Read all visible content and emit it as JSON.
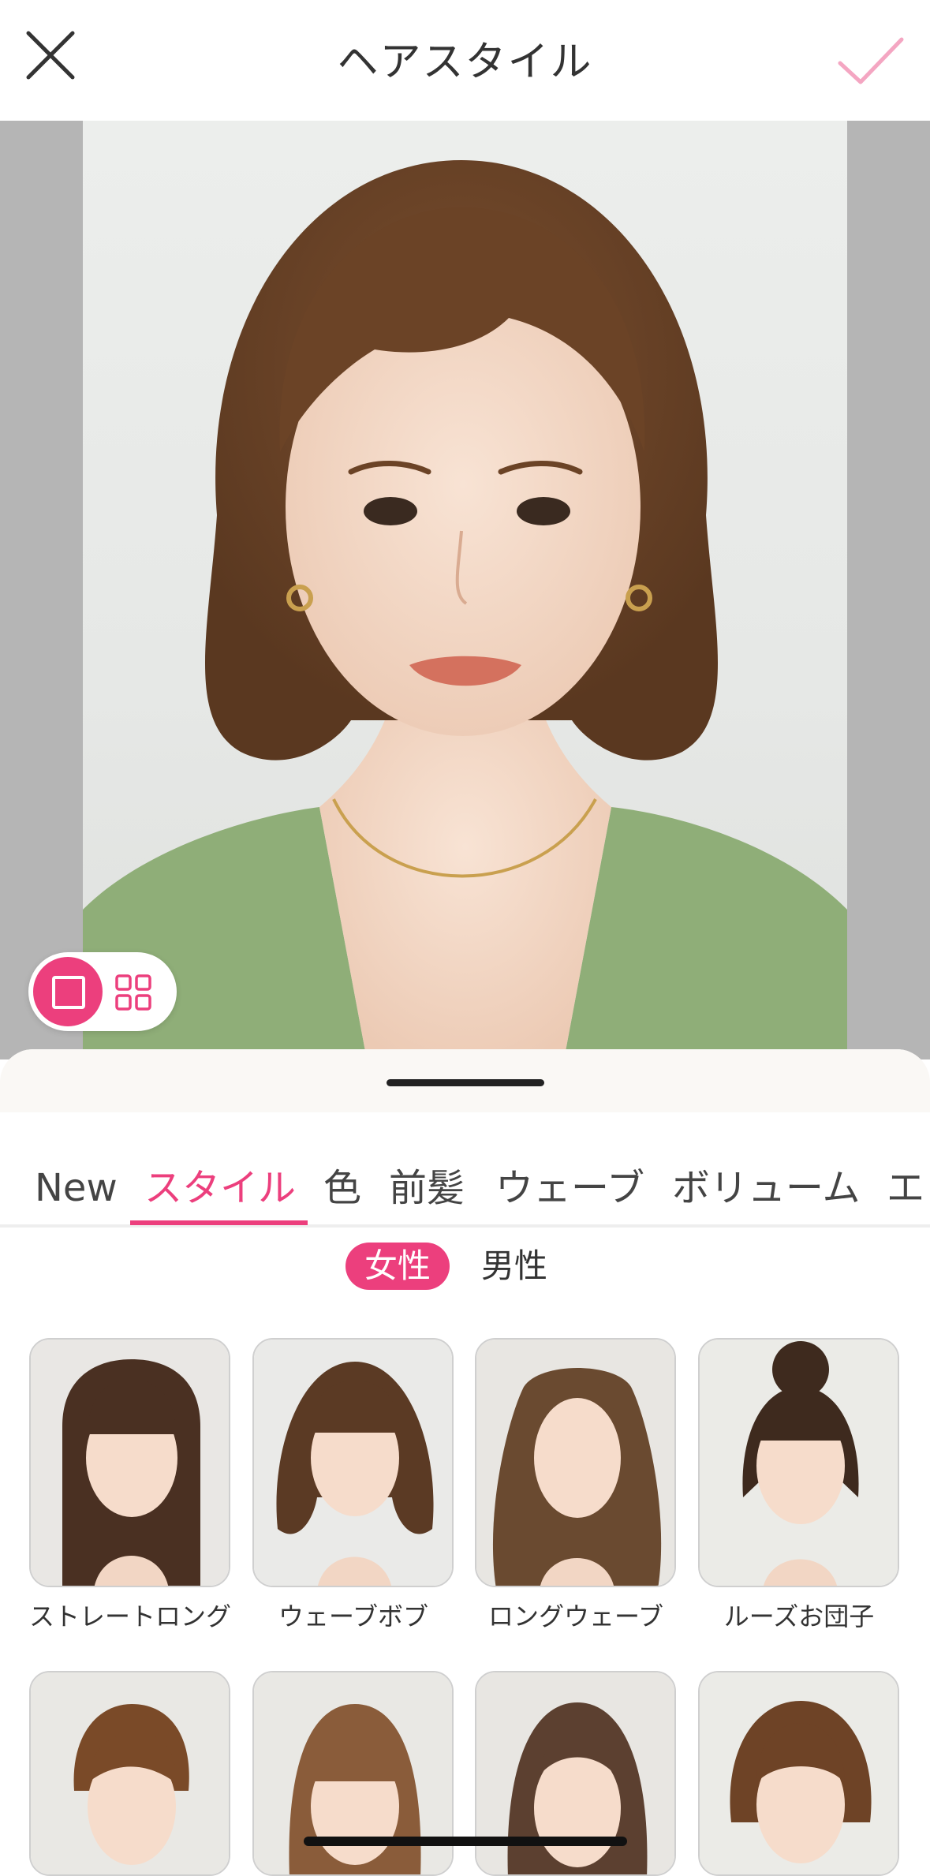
{
  "header": {
    "title": "ヘアスタイル",
    "close_icon": "close-icon",
    "confirm_icon": "check-icon",
    "accent_color": "#ec3f7d"
  },
  "preview": {
    "view_modes": [
      "single-view-icon",
      "grid-view-icon"
    ],
    "selected_view": "single-view-icon"
  },
  "tabs": [
    {
      "label": "New",
      "active": false
    },
    {
      "label": "スタイル",
      "active": true
    },
    {
      "label": "色",
      "active": false
    },
    {
      "label": "前髪",
      "active": false
    },
    {
      "label": "ウェーブ",
      "active": false
    },
    {
      "label": "ボリューム",
      "active": false
    },
    {
      "label": "エ",
      "active": false
    }
  ],
  "gender": {
    "options": [
      "女性",
      "男性"
    ],
    "selected": "女性"
  },
  "styles": [
    {
      "label": "ストレートロング"
    },
    {
      "label": "ウェーブボブ"
    },
    {
      "label": "ロングウェーブ"
    },
    {
      "label": "ルーズお団子"
    },
    {
      "label": ""
    },
    {
      "label": ""
    },
    {
      "label": ""
    },
    {
      "label": ""
    }
  ]
}
